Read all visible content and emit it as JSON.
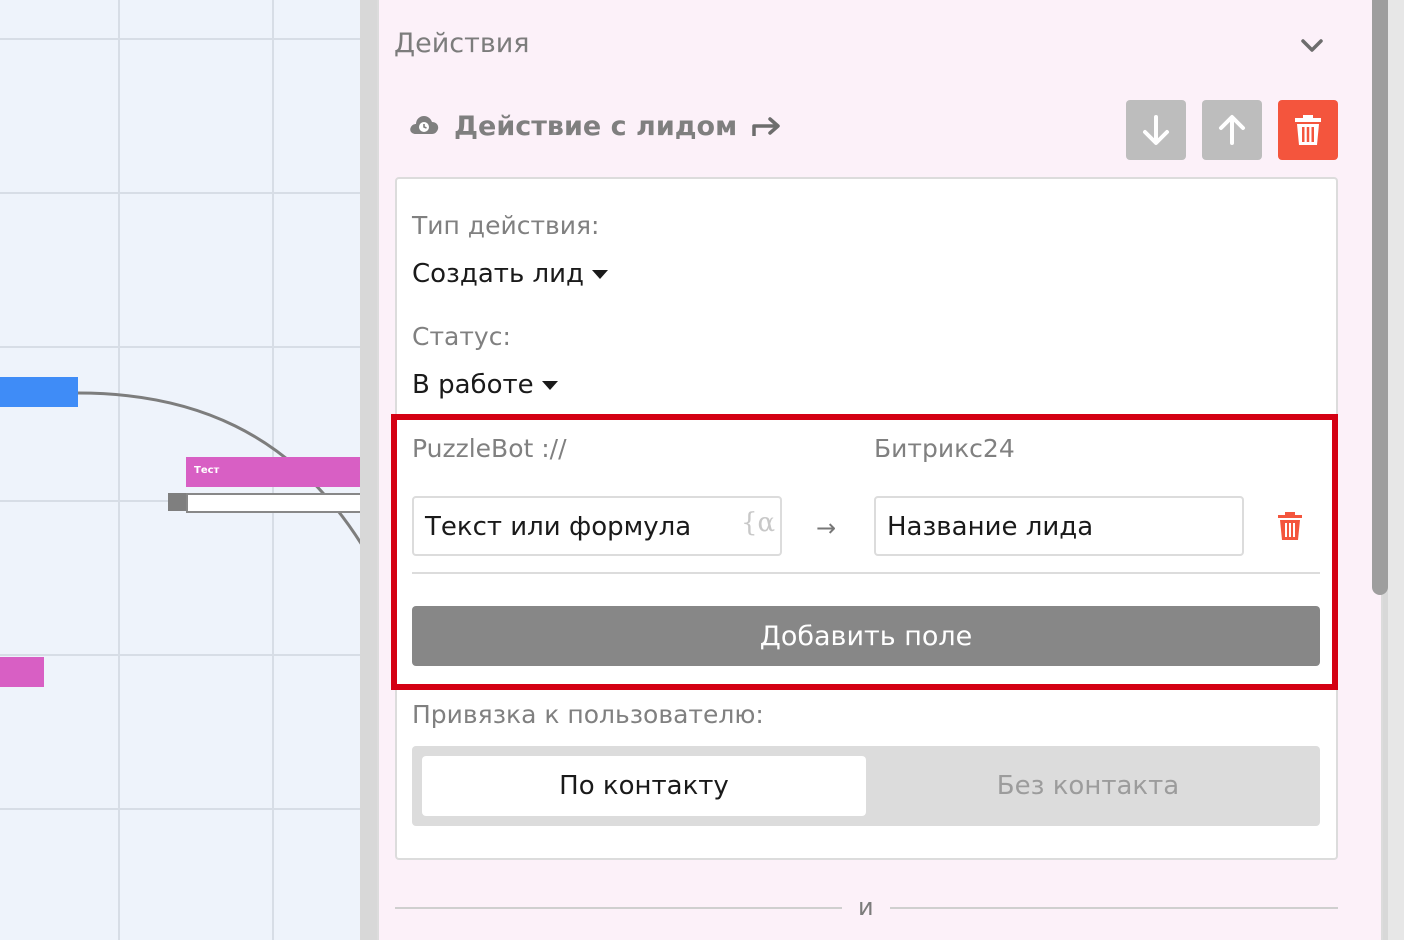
{
  "canvas": {
    "node_label": "Тест"
  },
  "panel": {
    "section_title": "Действия",
    "action": {
      "title": "Действие с лидом",
      "icon": "cloud-clock-icon"
    },
    "controls": {
      "move_down": "arrow-down-icon",
      "move_up": "arrow-up-icon",
      "delete": "trash-icon"
    },
    "action_type": {
      "label": "Тип действия:",
      "value": "Создать лид"
    },
    "status": {
      "label": "Статус:",
      "value": "В работе"
    },
    "mapping": {
      "source_header": "PuzzleBot ://",
      "target_header": "Битрикс24",
      "source_value": "Текст или формула",
      "formula_icon": "{α",
      "arrow": "→",
      "target_value": "Название лида",
      "add_button": "Добавить поле"
    },
    "binding": {
      "label": "Привязка к пользователю:",
      "options": [
        "По контакту",
        "Без контакта"
      ],
      "selected": "По контакту"
    },
    "separator": "и"
  },
  "colors": {
    "accent_red": "#d40013",
    "delete_red": "#f4553d",
    "panel_bg": "#fcf1f9",
    "node_blue": "#3f8cf7",
    "node_pink": "#d85fc4"
  }
}
